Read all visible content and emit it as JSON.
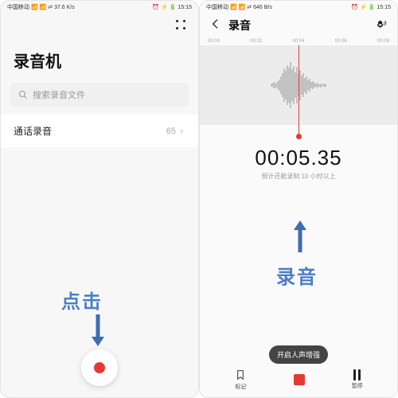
{
  "status": {
    "left": "中国移动 📶 📶 ⇄ 37.6 K/s",
    "icons": "⏰ ⚡ 🔋",
    "time": "15:15",
    "left2": "中国移动 📶 📶 ⇄ 646 B/s"
  },
  "left": {
    "title": "录音机",
    "search_placeholder": "搜索录音文件",
    "row_label": "通话录音",
    "row_count": "65",
    "annotation": "点击"
  },
  "right": {
    "title": "录音",
    "ruler": [
      "00:00",
      "00:02",
      "00:04",
      "00:06",
      "00:08"
    ],
    "timer": "00:05.35",
    "hint": "预计还能录制 10 小时以上",
    "annotation": "录音",
    "toast": "开启人声增强",
    "mark_label": "标记",
    "pause_label": "暂停"
  }
}
